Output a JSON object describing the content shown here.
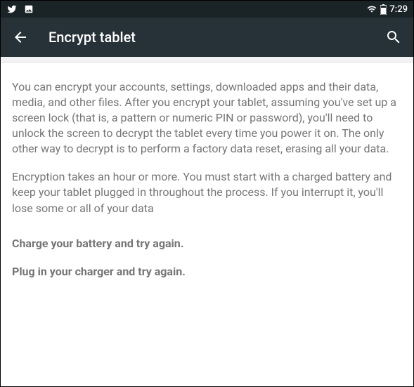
{
  "status_bar": {
    "time": "7:29"
  },
  "app_bar": {
    "title": "Encrypt tablet"
  },
  "content": {
    "paragraph1": "You can encrypt your accounts, settings, downloaded apps and their data, media, and other files. After you encrypt your tablet, assuming you've set up a screen lock (that is, a pattern or numeric PIN or password), you'll need to unlock the screen to decrypt the tablet every time you power it on. The only other way to decrypt is to perform a factory data reset, erasing all your data.",
    "paragraph2": "Encryption takes an hour or more. You must start with a charged battery and keep your tablet plugged in throughout the process. If you interrupt it, you'll lose some or all of your data",
    "warning_battery": "Charge your battery and try again.",
    "warning_charger": "Plug in your charger and try again."
  }
}
